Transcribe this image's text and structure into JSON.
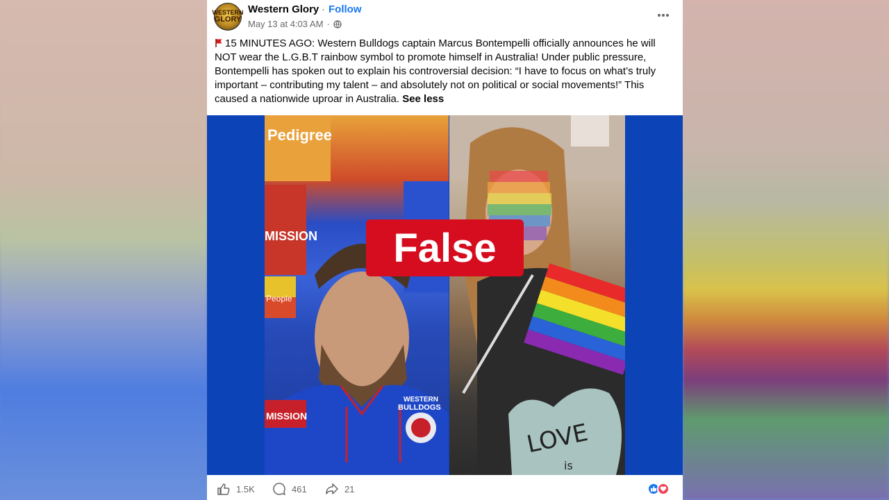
{
  "post": {
    "page_name": "Western Glory",
    "separator": "·",
    "follow_label": "Follow",
    "timestamp": "May 13 at 4:03 AM",
    "meta_separator": "·",
    "avatar_text_line1": "WESTERN",
    "avatar_text_line2": "GLORY",
    "caption": "15 MINUTES AGO: Western Bulldogs captain Marcus Bontempelli officially announces he will NOT wear the L.G.B.T rainbow symbol to promote himself in Australia! Under public pressure, Bontempelli has spoken out to explain his controversial decision: “I have to focus on what’s truly important – contributing my talent – and absolutely not on political or social movements!” This caused a nationwide uproar in Australia.",
    "see_less": "See less",
    "emoji_icon": "red-flag-icon"
  },
  "media": {
    "badge_label": "False",
    "badge_color": "#d50d1e",
    "background_color": "#0c44b8",
    "left_sponsor_1": "Pedigree",
    "left_sponsor_2": "MISSION",
    "left_sponsor_3": "People",
    "jacket_text_1": "WESTERN",
    "jacket_text_2": "BULLDOGS",
    "jacket_logo": "MISSION",
    "sign_text_1": "LOVE",
    "sign_text_2": "is"
  },
  "footer": {
    "likes": "1.5K",
    "comments": "461",
    "shares": "21",
    "like_icon": "thumbs-up-icon",
    "comment_icon": "comment-icon",
    "share_icon": "share-icon"
  },
  "colors": {
    "link": "#1877f2",
    "like_blue": "#1877f2",
    "love_red": "#f33e58"
  }
}
